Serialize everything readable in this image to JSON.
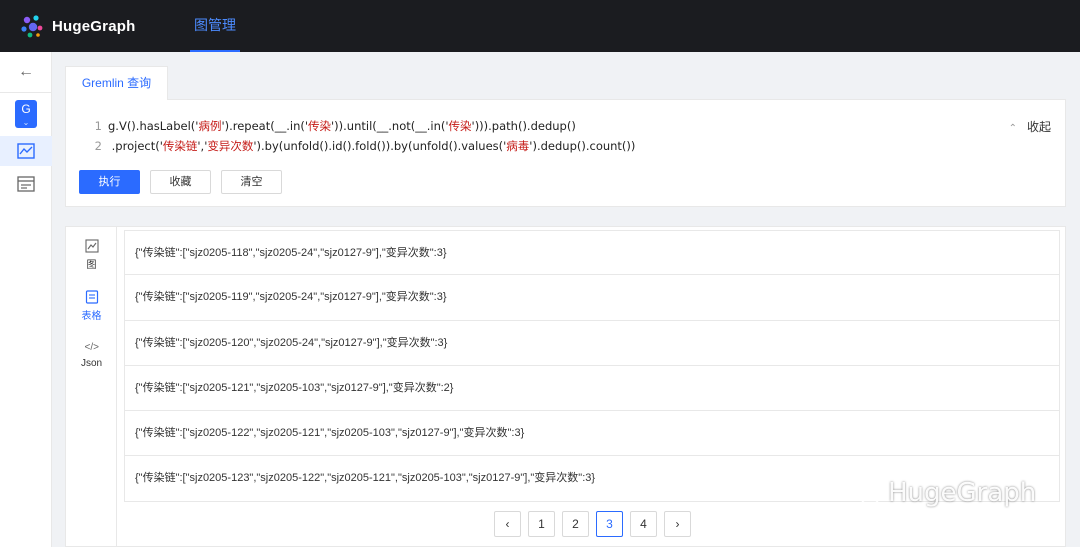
{
  "app": {
    "name": "HugeGraph"
  },
  "nav": {
    "graph_manage": "图管理"
  },
  "query": {
    "tab_label": "Gremlin 查询",
    "lines": [
      {
        "n": "1",
        "parts": [
          {
            "t": "g.V().hasLabel('",
            "s": false
          },
          {
            "t": "病例",
            "s": true
          },
          {
            "t": "').repeat(__.in('",
            "s": false
          },
          {
            "t": "传染",
            "s": true
          },
          {
            "t": "')).until(__.not(__.in('",
            "s": false
          },
          {
            "t": "传染",
            "s": true
          },
          {
            "t": "'))).path().dedup()",
            "s": false
          }
        ]
      },
      {
        "n": "2",
        "parts": [
          {
            "t": " .project('",
            "s": false
          },
          {
            "t": "传染链",
            "s": true
          },
          {
            "t": "','",
            "s": false
          },
          {
            "t": "变异次数",
            "s": true
          },
          {
            "t": "').by(unfold().id().fold()).by(unfold().values('",
            "s": false
          },
          {
            "t": "病毒",
            "s": true
          },
          {
            "t": "').dedup().count())",
            "s": false
          }
        ]
      }
    ],
    "collapse_label": "收起",
    "run_label": "执行",
    "favorite_label": "收藏",
    "clear_label": "清空"
  },
  "sidebar": {
    "graph_badge": "G"
  },
  "result": {
    "view_tabs": [
      {
        "label": "图",
        "icon": "graph-icon"
      },
      {
        "label": "表格",
        "icon": "table-icon"
      },
      {
        "label": "Json",
        "icon": "code-icon"
      }
    ],
    "rows": [
      "{\"传染链\":[\"sjz0205-118\",\"sjz0205-24\",\"sjz0127-9\"],\"变异次数\":3}",
      "{\"传染链\":[\"sjz0205-119\",\"sjz0205-24\",\"sjz0127-9\"],\"变异次数\":3}",
      "{\"传染链\":[\"sjz0205-120\",\"sjz0205-24\",\"sjz0127-9\"],\"变异次数\":3}",
      "{\"传染链\":[\"sjz0205-121\",\"sjz0205-103\",\"sjz0127-9\"],\"变异次数\":2}",
      "{\"传染链\":[\"sjz0205-122\",\"sjz0205-121\",\"sjz0205-103\",\"sjz0127-9\"],\"变异次数\":3}",
      "{\"传染链\":[\"sjz0205-123\",\"sjz0205-122\",\"sjz0205-121\",\"sjz0205-103\",\"sjz0127-9\"],\"变异次数\":3}"
    ],
    "pagination": {
      "pages": [
        "1",
        "2",
        "3",
        "4"
      ],
      "current": "3"
    }
  },
  "watermark": {
    "text": "HugeGraph"
  },
  "colors": {
    "accent": "#2b6bff",
    "header_bg": "#1b1c20",
    "string": "#c41a16"
  }
}
